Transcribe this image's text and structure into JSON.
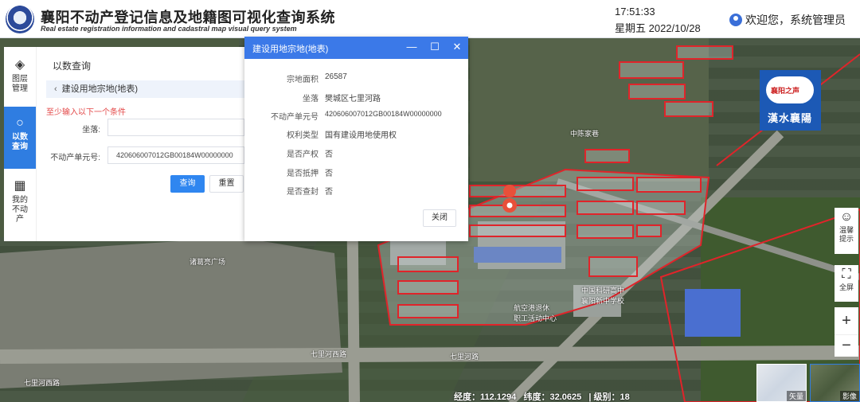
{
  "header": {
    "title_cn": "襄阳不动产登记信息及地籍图可视化查询系统",
    "title_en": "Real estate registration information and cadastral map visual query system",
    "time": "17:51:33",
    "date": "星期五  2022/10/28",
    "welcome": "欢迎您，系统管理员"
  },
  "sidenav": {
    "items": [
      {
        "label": "图层管理",
        "icon": "layers-icon",
        "glyph": "◈"
      },
      {
        "label": "以数查询",
        "icon": "search-icon",
        "glyph": "○"
      },
      {
        "label": "我的不动产",
        "icon": "building-icon",
        "glyph": "▦"
      }
    ]
  },
  "query": {
    "title": "以数查询",
    "breadcrumb": "建设用地宗地(地表)",
    "hint": "至少输入以下一个条件",
    "location_label": "坐落:",
    "location_value": "",
    "unit_label": "不动产单元号:",
    "unit_value": "420606007012GB00184W00000000",
    "search_label": "查询",
    "reset_label": "重置"
  },
  "dialog": {
    "title": "建设用地宗地(地表)",
    "rows": [
      {
        "key": "宗地面积",
        "value": "26587"
      },
      {
        "key": "坐落",
        "value": "樊城区七里河路"
      },
      {
        "key": "不动产单元号",
        "value": "420606007012GB00184W00000000"
      },
      {
        "key": "权利类型",
        "value": "国有建设用地使用权"
      },
      {
        "key": "是否产权",
        "value": "否"
      },
      {
        "key": "是否抵押",
        "value": "否"
      },
      {
        "key": "是否查封",
        "value": "否"
      }
    ],
    "close_label": "关闭"
  },
  "banner": {
    "line1": "襄阳之声",
    "line2": "漢水襄陽"
  },
  "map": {
    "labels": {
      "square": "诸葛亮广场",
      "road1": "七里河西路",
      "road2": "七里河西路",
      "road3": "七里河路",
      "market": "中陈家巷",
      "school": "中国科研高中\n襄阳新中学校",
      "park": "航空港退休\n职工活动中心"
    }
  },
  "tools": {
    "tip": "温馨提示",
    "fullscreen": "全屏",
    "zoom_in": "+",
    "zoom_out": "−"
  },
  "basemaps": {
    "vector": "矢量",
    "image": "影像"
  },
  "status": {
    "lng_label": "经度：",
    "lng": "112.1294",
    "lat_label": "纬度：",
    "lat": "32.0625",
    "level_label": "级别：",
    "level": "18"
  },
  "colors": {
    "accent": "#2f7de1",
    "dialog_header": "#3b79e8",
    "parcel_outline": "#e0242a"
  }
}
